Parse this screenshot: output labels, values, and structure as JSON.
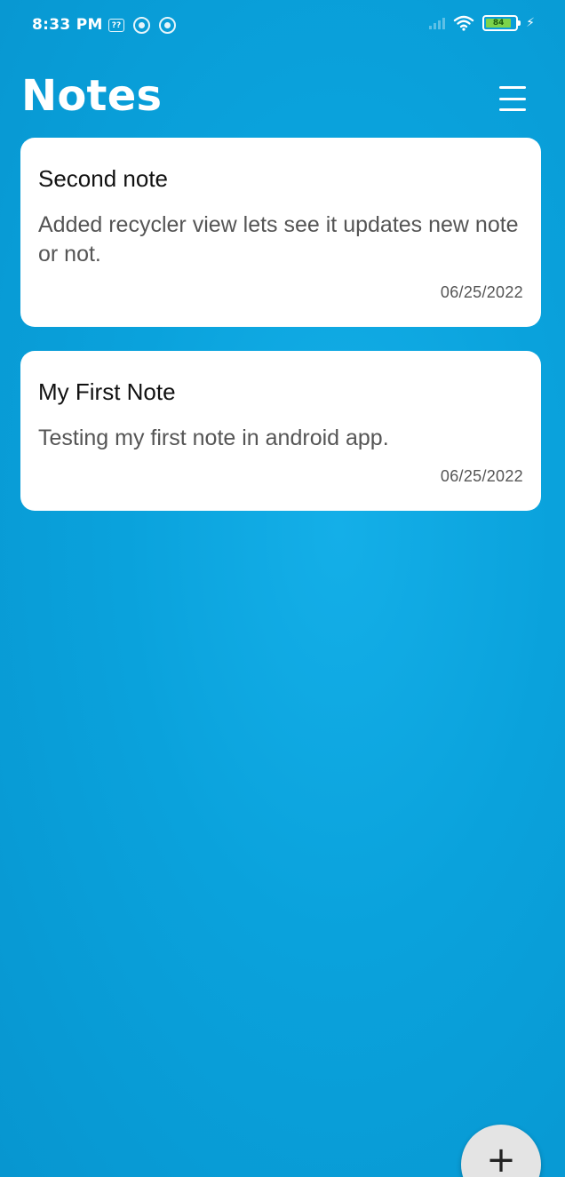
{
  "status_bar": {
    "time": "8:33 PM",
    "left_icons": [
      "notification-box-icon",
      "sync-circle-icon",
      "sync-circle-icon"
    ],
    "battery_level": "84",
    "charging": true
  },
  "header": {
    "title": "Notes",
    "menu_icon": "hamburger-menu-icon"
  },
  "notes": [
    {
      "title": "Second note",
      "body": "Added recycler view lets see it updates new note or not.",
      "date": "06/25/2022"
    },
    {
      "title": "My First Note",
      "body": "Testing my first note in android app.",
      "date": "06/25/2022"
    }
  ],
  "fab": {
    "label": "+",
    "icon": "add-icon"
  },
  "colors": {
    "background": "#0ba3dc",
    "card": "#ffffff",
    "fab": "#e4e4e4",
    "battery": "#7cd34b"
  }
}
